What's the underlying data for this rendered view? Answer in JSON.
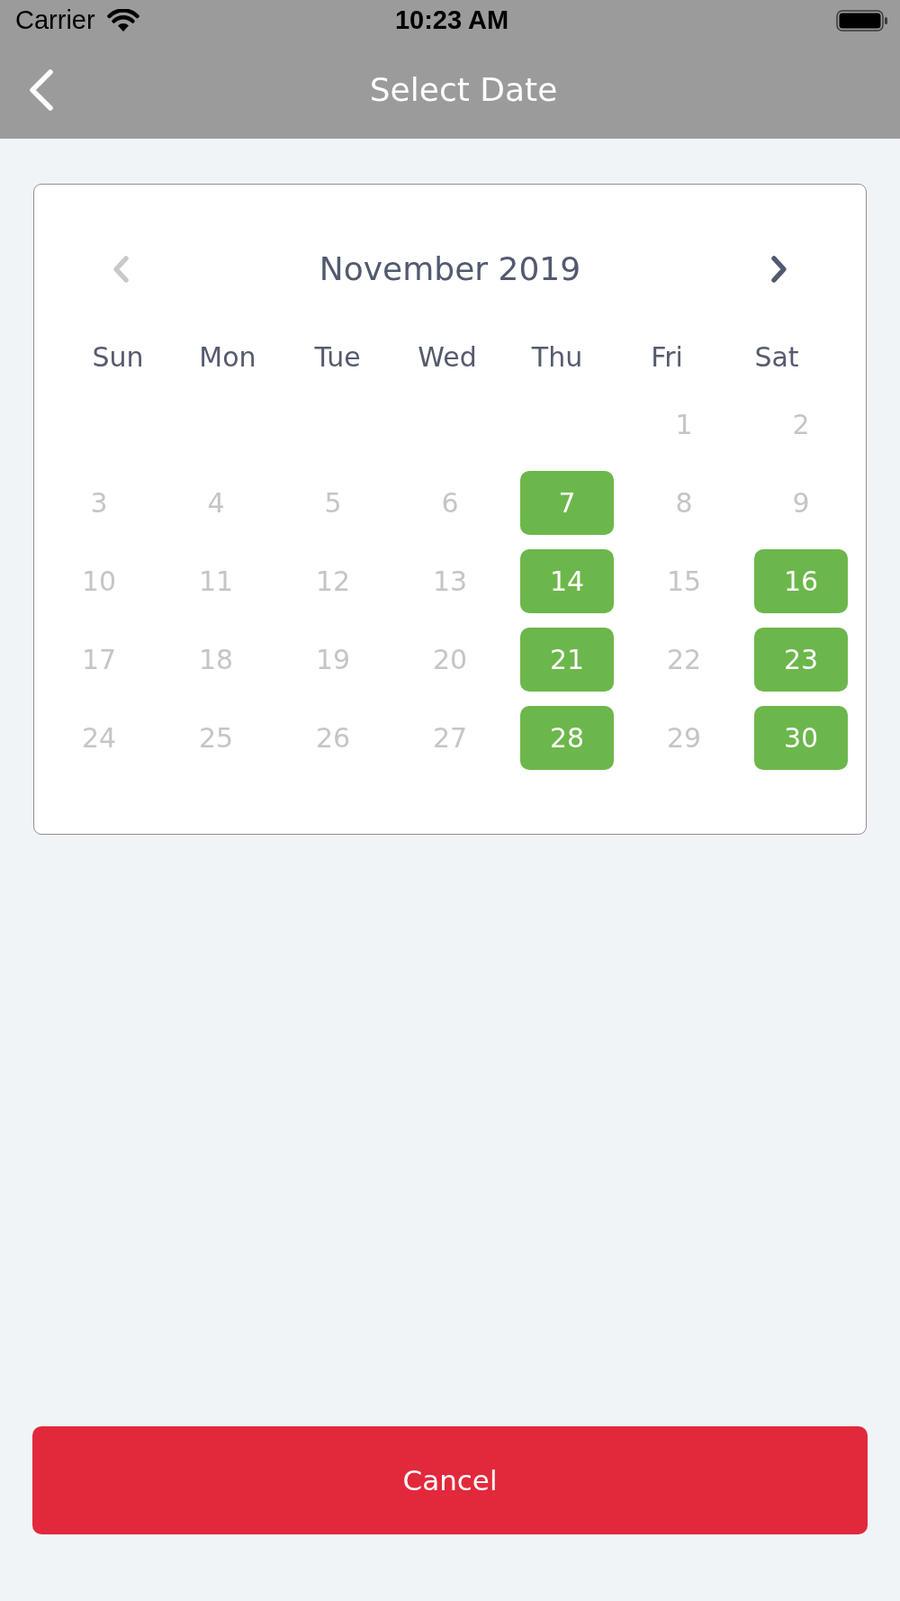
{
  "status_bar": {
    "carrier": "Carrier",
    "time": "10:23 AM"
  },
  "nav_bar": {
    "title": "Select Date"
  },
  "calendar": {
    "month": "November 2019",
    "prev_month": {
      "disabled": true
    },
    "next_month": {
      "disabled": false
    },
    "weekdays": [
      "Sun",
      "Mon",
      "Tue",
      "Wed",
      "Thu",
      "Fri",
      "Sat"
    ],
    "weeks": [
      {
        "days": [
          {
            "label": "1",
            "available": false
          },
          {
            "label": "2",
            "available": false
          }
        ]
      },
      {
        "days": [
          {
            "label": "3",
            "available": false
          },
          {
            "label": "4",
            "available": false
          },
          {
            "label": "5",
            "available": false
          },
          {
            "label": "6",
            "available": false
          },
          {
            "label": "7",
            "available": true
          },
          {
            "label": "8",
            "available": false
          },
          {
            "label": "9",
            "available": false
          }
        ]
      },
      {
        "days": [
          {
            "label": "10",
            "available": false
          },
          {
            "label": "11",
            "available": false
          },
          {
            "label": "12",
            "available": false
          },
          {
            "label": "13",
            "available": false
          },
          {
            "label": "14",
            "available": true
          },
          {
            "label": "15",
            "available": false
          },
          {
            "label": "16",
            "available": true
          }
        ]
      },
      {
        "days": [
          {
            "label": "17",
            "available": false
          },
          {
            "label": "18",
            "available": false
          },
          {
            "label": "19",
            "available": false
          },
          {
            "label": "20",
            "available": false
          },
          {
            "label": "21",
            "available": true
          },
          {
            "label": "22",
            "available": false
          },
          {
            "label": "23",
            "available": true
          }
        ]
      },
      {
        "days": [
          {
            "label": "24",
            "available": false
          },
          {
            "label": "25",
            "available": false
          },
          {
            "label": "26",
            "available": false
          },
          {
            "label": "27",
            "available": false
          },
          {
            "label": "28",
            "available": true
          },
          {
            "label": "29",
            "available": false
          },
          {
            "label": "30",
            "available": true
          }
        ]
      }
    ]
  },
  "cancel_button": {
    "label": "Cancel"
  }
}
